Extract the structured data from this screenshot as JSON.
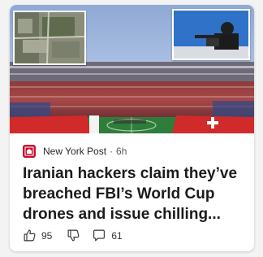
{
  "card": {
    "source": "New York Post",
    "separator": "·",
    "age": "6h",
    "headline": "Iranian hackers claim they’ve breached FBI’s World Cup drones and issue chilling...",
    "likes": "95",
    "comments": "61"
  },
  "colors": {
    "source_logo": "#c8102e",
    "sky": "#9fb7dc",
    "pitch_green": "#2f7d3a",
    "flag_red": "#d02a2a"
  },
  "icons": {
    "like": "thumbs-up-icon",
    "dislike": "thumbs-down-icon",
    "comment": "comment-icon",
    "logo": "new-york-post-logo"
  }
}
